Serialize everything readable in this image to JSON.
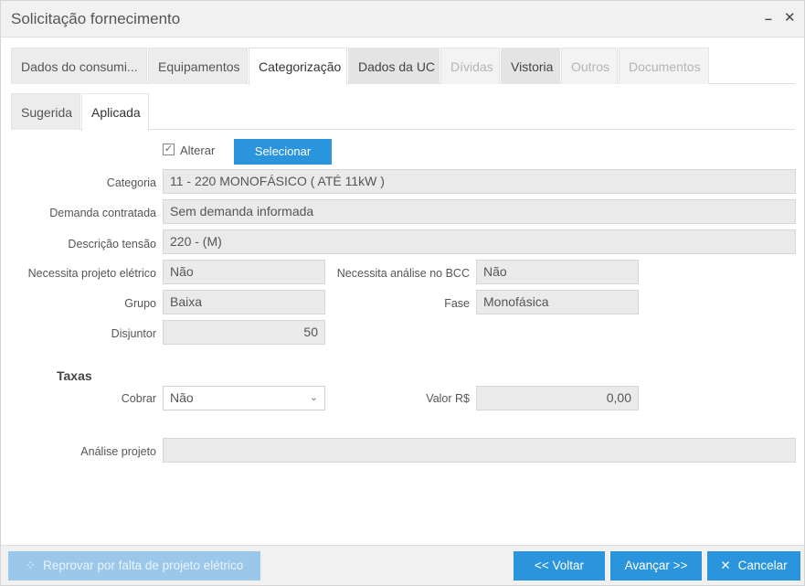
{
  "window": {
    "title": "Solicitação fornecimento",
    "minimize_glyph": "–",
    "close_glyph": "✕"
  },
  "tabs_main": [
    {
      "label": "Dados do consumi...",
      "state": "normal"
    },
    {
      "label": "Equipamentos",
      "state": "normal"
    },
    {
      "label": "Categorização",
      "state": "active"
    },
    {
      "label": "Dados da UC",
      "state": "dark"
    },
    {
      "label": "Dívidas",
      "state": "disabled"
    },
    {
      "label": "Vistoria",
      "state": "dark"
    },
    {
      "label": "Outros",
      "state": "disabled"
    },
    {
      "label": "Documentos",
      "state": "disabled"
    }
  ],
  "tabs_sub": [
    {
      "label": "Sugerida",
      "state": "normal"
    },
    {
      "label": "Aplicada",
      "state": "active"
    }
  ],
  "alterar": {
    "label": "Alterar",
    "checked": true,
    "check_glyph": "✓"
  },
  "selecionar_label": "Selecionar",
  "form": {
    "categoria": {
      "label": "Categoria",
      "value": "11 - 220 MONOFÁSICO ( ATÉ 11kW )"
    },
    "demanda": {
      "label": "Demanda contratada",
      "value": "Sem demanda informada"
    },
    "tensao": {
      "label": "Descrição tensão",
      "value": "220 - (M)"
    },
    "projeto_eletrico": {
      "label": "Necessita projeto elétrico",
      "value": "Não"
    },
    "analise_bcc": {
      "label": "Necessita análise no BCC",
      "value": "Não"
    },
    "grupo": {
      "label": "Grupo",
      "value": "Baixa"
    },
    "fase": {
      "label": "Fase",
      "value": "Monofásica"
    },
    "disjuntor": {
      "label": "Disjuntor",
      "value": "50"
    }
  },
  "taxas": {
    "title": "Taxas",
    "cobrar": {
      "label": "Cobrar",
      "value": "Não",
      "chevron_glyph": "⌄"
    },
    "valor": {
      "label": "Valor R$",
      "value": "0,00"
    }
  },
  "analise_projeto": {
    "label": "Análise projeto",
    "value": ""
  },
  "footer": {
    "reprovar_label": "Reprovar por falta de projeto elétrico",
    "reprovar_icon": "spinner-icon",
    "reprovar_glyph": "⁘",
    "voltar_label": "<< Voltar",
    "avancar_label": "Avançar >>",
    "cancelar_label": "Cancelar",
    "cancelar_glyph": "✕"
  },
  "colors": {
    "accent": "#2a95dc",
    "disabled_button": "#9bc8ea"
  }
}
